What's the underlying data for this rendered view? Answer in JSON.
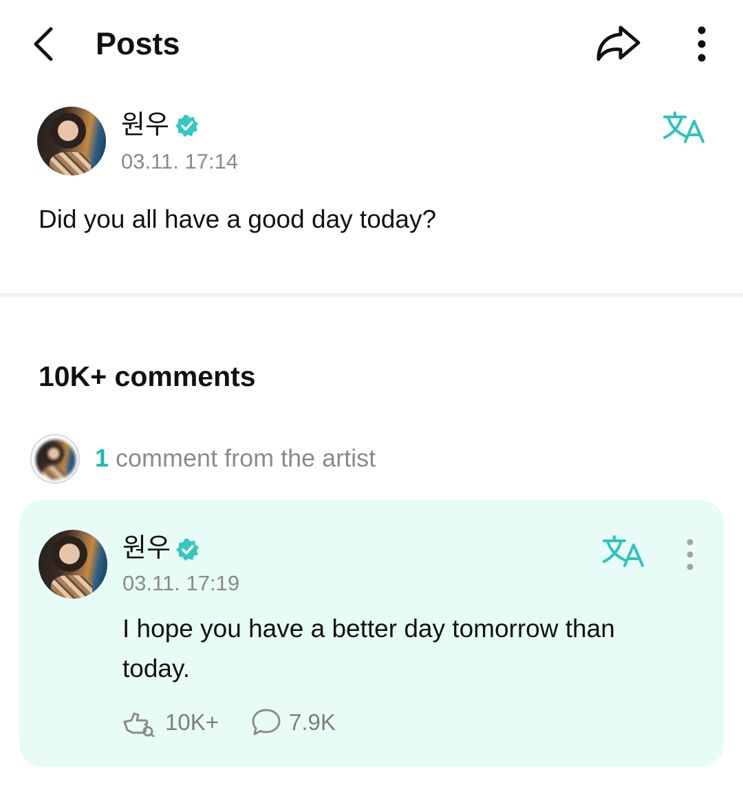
{
  "header": {
    "title": "Posts",
    "back_icon": "chevron-left-icon",
    "share_icon": "share-arrow-icon",
    "more_icon": "more-vertical-icon"
  },
  "post": {
    "author": "원우",
    "timestamp": "03.11. 17:14",
    "body": "Did you all have a good day today?",
    "translate_icon": "translate-icon",
    "verified_icon": "verified-badge-icon"
  },
  "comments": {
    "count_label": "10K+ comments",
    "artist_summary": {
      "count": "1",
      "text": "comment from the artist"
    },
    "highlighted": {
      "author": "원우",
      "timestamp": "03.11. 17:19",
      "body": "I hope you have a better day tomorrow than today.",
      "likes": "10K+",
      "replies": "7.9K"
    }
  },
  "colors": {
    "accent": "#1bb8b2",
    "card_background": "#e7fbf7",
    "muted_text": "#8a8a8a"
  }
}
